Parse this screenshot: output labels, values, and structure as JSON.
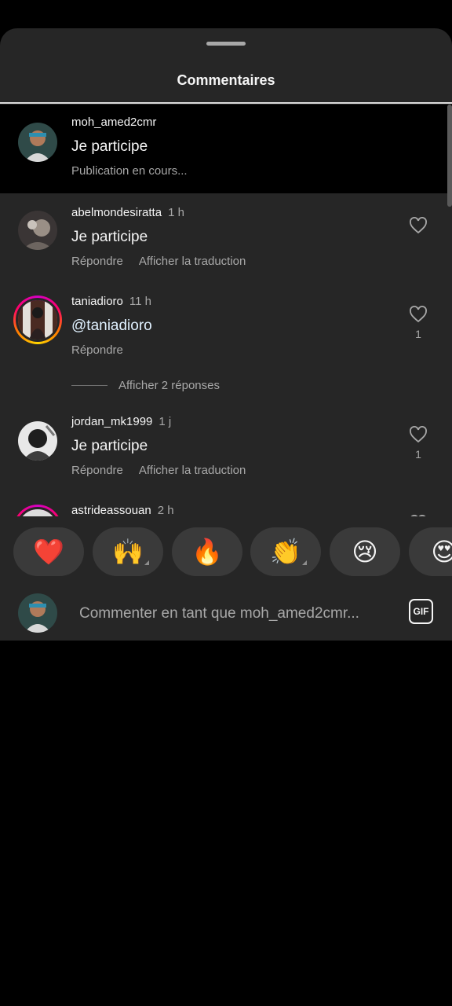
{
  "sheet": {
    "title": "Commentaires"
  },
  "pending_comment": {
    "username": "moh_amed2cmr",
    "text": "Je participe",
    "status": "Publication en cours..."
  },
  "comments": [
    {
      "username": "abelmondesiratta",
      "time": "1 h",
      "text": "Je participe",
      "reply_label": "Répondre",
      "translate_label": "Afficher la traduction",
      "likes": ""
    },
    {
      "username": "taniadioro",
      "time": "11 h",
      "text": "@taniadioro",
      "reply_label": "Répondre",
      "likes": "1",
      "replies_label": "Afficher 2 réponses"
    },
    {
      "username": "jordan_mk1999",
      "time": "1 j",
      "text": "Je participe",
      "reply_label": "Répondre",
      "translate_label": "Afficher la traduction",
      "likes": "1"
    },
    {
      "username": "astrideassouan",
      "time": "2 h"
    }
  ],
  "emoji_reactions": [
    {
      "icon": "heart-emoji",
      "glyph": "❤️"
    },
    {
      "icon": "raising-hands-emoji",
      "glyph": "🙌"
    },
    {
      "icon": "fire-emoji",
      "glyph": "🔥"
    },
    {
      "icon": "clapping-hands-emoji",
      "glyph": "👏"
    },
    {
      "icon": "crying-face-emoji",
      "glyph": "😢"
    },
    {
      "icon": "heart-eyes-emoji",
      "glyph": "😍"
    }
  ],
  "composer": {
    "placeholder": "Commenter en tant que moh_amed2cmr...",
    "gif_label": "GIF"
  },
  "colors": {
    "sheet_bg": "#262626",
    "pending_bg": "#000000",
    "secondary_text": "#a8a8a8",
    "story_ring": [
      "#d300c5",
      "#ff0069",
      "#ff7a00",
      "#ffd600"
    ]
  }
}
